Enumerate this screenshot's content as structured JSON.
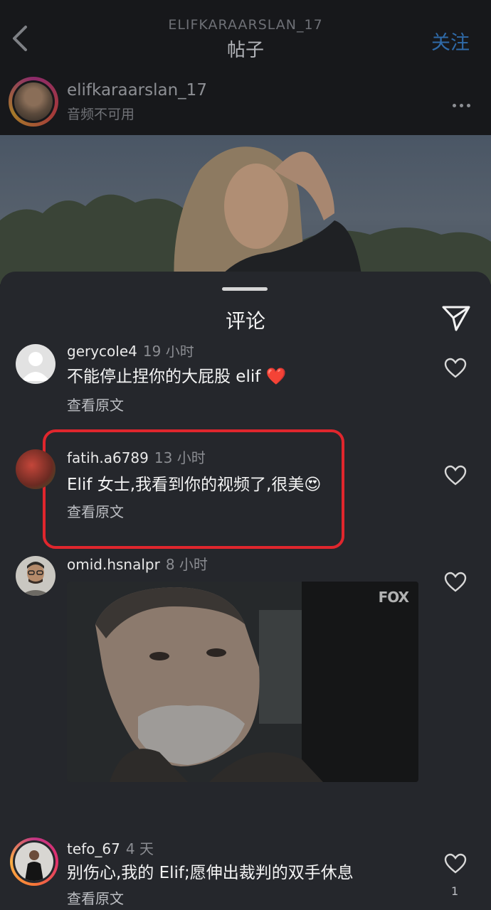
{
  "header": {
    "username": "ELIFKARAARSLAN_17",
    "title": "帖子",
    "follow_label": "关注",
    "icons": [
      "back-icon",
      "more-icon"
    ]
  },
  "post": {
    "author": "elifkaraarslan_17",
    "subtitle": "音频不可用"
  },
  "comments_sheet": {
    "title": "评论",
    "share_icon": "send-icon",
    "comments": [
      {
        "username": "gerycole4",
        "time": "19 小时",
        "text": "不能停止捏你的大屁股 elif ❤️",
        "translate_label": "查看原文"
      },
      {
        "username": "fatih.a6789",
        "time": "13 小时",
        "text": "Elif 女士,我看到你的视频了,很美😍",
        "translate_label": "查看原文"
      },
      {
        "username": "omid.hsnalpr",
        "time": "8 小时",
        "gif_badge": "FOX"
      },
      {
        "username": "tefo_67",
        "time": "4 天",
        "text": "别伤心,我的 Elif;愿伸出裁判的双手休息",
        "translate_label": "查看原文",
        "likes": "1"
      }
    ]
  },
  "colors": {
    "highlight": "#e0262d",
    "follow": "#2f6aa8",
    "background": "#25272c"
  }
}
